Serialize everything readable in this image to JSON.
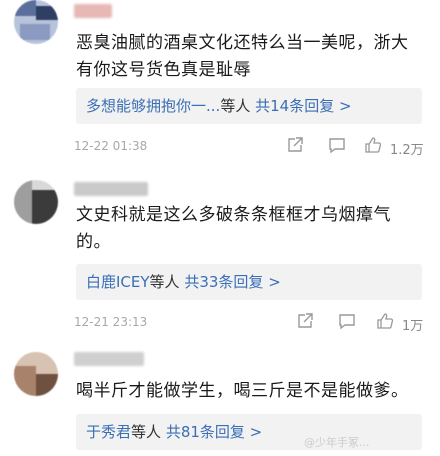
{
  "comments": [
    {
      "avatar_colors": [
        "#5b6f9c",
        "#b7c3da",
        "#2f3f63"
      ],
      "username_color": "#e7b8b5",
      "text": "恶臭油腻的酒桌文化还特么当一美呢，浙大有你这号货色真是耻辱",
      "reply": {
        "names": "多想能够拥抱你一...",
        "suffix": "等人",
        "count": "共14条回复 >"
      },
      "timestamp": "12-22 01:38",
      "likes": "1.2万",
      "icons": [
        "share-icon",
        "comment-icon",
        "like-icon"
      ]
    },
    {
      "avatar_colors": [
        "#3b3b3b",
        "#9e9e9e",
        "#d9d9d9"
      ],
      "username_color": "#c9c9c9",
      "text": "文史科就是这么多破条条框框才乌烟瘴气的。",
      "reply": {
        "names": "白鹿ICEY",
        "suffix": "等人",
        "count": "共33条回复 >"
      },
      "timestamp": "12-21 23:13",
      "likes": "1万",
      "icons": [
        "share-icon",
        "comment-icon",
        "like-icon"
      ]
    },
    {
      "avatar_colors": [
        "#a9826b",
        "#d8c2b2",
        "#6f513f"
      ],
      "username_color": "#cfcfcf",
      "text": "喝半斤才能做学生，喝三斤是不是能做爹。",
      "reply": {
        "names": "于秀君",
        "suffix": "等人",
        "count": "共81条回复 >"
      },
      "timestamp": "",
      "likes": "",
      "icons": []
    }
  ],
  "watermark": "@少年手冢...",
  "colors": {
    "link": "#3a6fb5",
    "reply_bg": "#f2f2f2",
    "meta_gray": "#a8a8a8"
  }
}
